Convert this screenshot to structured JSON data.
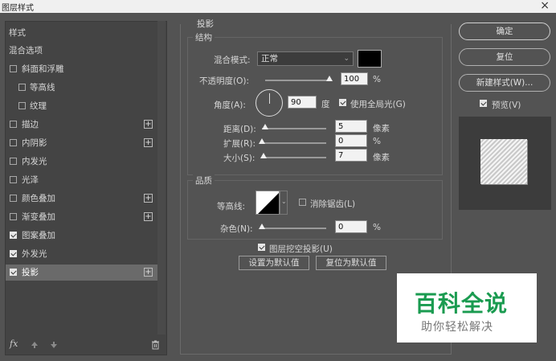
{
  "window": {
    "title": "图层样式",
    "close_glyph": "×"
  },
  "left_panel": {
    "header": "样式",
    "items": [
      {
        "label": "混合选项",
        "checkbox": null,
        "plus": false,
        "indent": false,
        "selected": false
      },
      {
        "label": "斜面和浮雕",
        "checkbox": false,
        "plus": false,
        "indent": false,
        "selected": false
      },
      {
        "label": "等高线",
        "checkbox": false,
        "plus": false,
        "indent": true,
        "selected": false
      },
      {
        "label": "纹理",
        "checkbox": false,
        "plus": false,
        "indent": true,
        "selected": false
      },
      {
        "label": "描边",
        "checkbox": false,
        "plus": true,
        "indent": false,
        "selected": false
      },
      {
        "label": "内阴影",
        "checkbox": false,
        "plus": true,
        "indent": false,
        "selected": false
      },
      {
        "label": "内发光",
        "checkbox": false,
        "plus": false,
        "indent": false,
        "selected": false
      },
      {
        "label": "光泽",
        "checkbox": false,
        "plus": false,
        "indent": false,
        "selected": false
      },
      {
        "label": "颜色叠加",
        "checkbox": false,
        "plus": true,
        "indent": false,
        "selected": false
      },
      {
        "label": "渐变叠加",
        "checkbox": false,
        "plus": true,
        "indent": false,
        "selected": false
      },
      {
        "label": "图案叠加",
        "checkbox": true,
        "plus": false,
        "indent": false,
        "selected": false
      },
      {
        "label": "外发光",
        "checkbox": true,
        "plus": false,
        "indent": false,
        "selected": false
      },
      {
        "label": "投影",
        "checkbox": true,
        "plus": true,
        "indent": false,
        "selected": true
      }
    ],
    "fx_label": "fx"
  },
  "drop_shadow": {
    "title": "投影",
    "structure": {
      "title": "结构",
      "blend_mode_label": "混合模式:",
      "blend_mode_value": "正常",
      "opacity_label": "不透明度(O):",
      "opacity_value": "100",
      "opacity_unit": "%",
      "opacity_level_pct": 100,
      "angle_label": "角度(A):",
      "angle_value": "90",
      "angle_unit": "度",
      "global_light_label": "使用全局光(G)",
      "global_light_checked": true,
      "distance_label": "距离(D):",
      "distance_value": "5",
      "distance_unit": "像素",
      "distance_level_pct": 5,
      "spread_label": "扩展(R):",
      "spread_value": "0",
      "spread_unit": "%",
      "spread_level_pct": 0,
      "size_label": "大小(S):",
      "size_value": "7",
      "size_unit": "像素",
      "size_level_pct": 3,
      "shadow_color": "#000000"
    },
    "quality": {
      "title": "品质",
      "contour_label": "等高线:",
      "anti_alias_label": "消除锯齿(L)",
      "anti_alias_checked": false,
      "noise_label": "杂色(N):",
      "noise_value": "0",
      "noise_unit": "%",
      "noise_level_pct": 0
    },
    "knockout_label": "图层挖空投影(U)",
    "knockout_checked": true,
    "set_default_label": "设置为默认值",
    "reset_default_label": "复位为默认值"
  },
  "right_panel": {
    "ok_label": "确定",
    "reset_label": "复位",
    "new_style_label": "新建样式(W)...",
    "preview_label": "预览(V)",
    "preview_checked": true
  },
  "watermark": {
    "title": "百科全说",
    "subtitle": "助你轻松解决"
  },
  "colors": {
    "accent": "#1a9b50",
    "panel": "#535353",
    "list": "#444444",
    "selected_row": "#6a6a6a"
  }
}
